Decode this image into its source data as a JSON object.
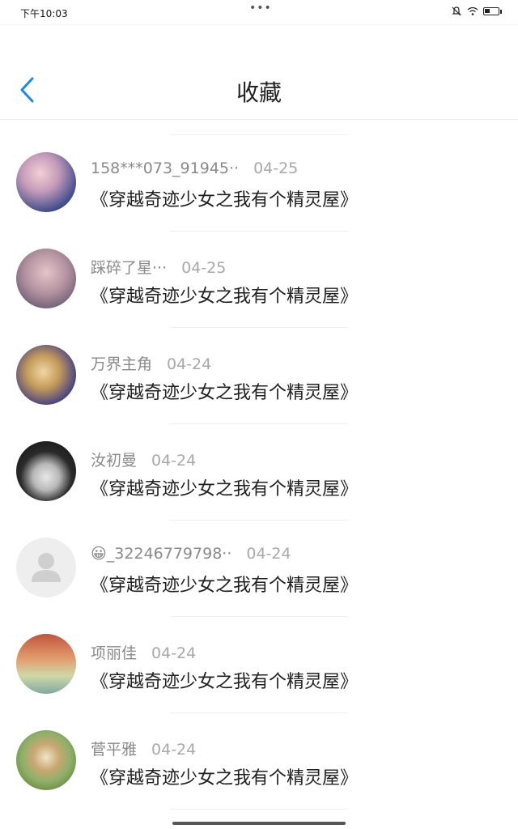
{
  "status": {
    "time": "下午10:03",
    "dots": "•••"
  },
  "header": {
    "title": "收藏"
  },
  "items": [
    {
      "name": "158***073_91945··",
      "date": "04-25",
      "book": "《穿越奇迹少女之我有个精灵屋》",
      "avatar_color1": "#e9b7c5",
      "avatar_color2": "#3b3f7a"
    },
    {
      "name": "踩碎了星···",
      "date": "04-25",
      "book": "《穿越奇迹少女之我有个精灵屋》",
      "avatar_color1": "#caa6a8",
      "avatar_color2": "#6b5f7a"
    },
    {
      "name": "万界主角",
      "date": "04-24",
      "book": "《穿越奇迹少女之我有个精灵屋》",
      "avatar_color1": "#c8a35f",
      "avatar_color2": "#3b3d6e"
    },
    {
      "name": "汝初曼",
      "date": "04-24",
      "book": "《穿越奇迹少女之我有个精灵屋》",
      "avatar_color1": "#1e1e1e",
      "avatar_color2": "#e8e8e8"
    },
    {
      "name": "😀_32246779798··",
      "date": "04-24",
      "book": "《穿越奇迹少女之我有个精灵屋》",
      "avatar_color1": "#eeeeee",
      "avatar_color2": "#dadada"
    },
    {
      "name": "项丽佳",
      "date": "04-24",
      "book": "《穿越奇迹少女之我有个精灵屋》",
      "avatar_color1": "#d2886a",
      "avatar_color2": "#cfe0b2"
    },
    {
      "name": "菅平雅",
      "date": "04-24",
      "book": "《穿越奇迹少女之我有个精灵屋》",
      "avatar_color1": "#a8c27a",
      "avatar_color2": "#d8b07a"
    }
  ],
  "colors": {
    "accent": "#1e88e5"
  }
}
